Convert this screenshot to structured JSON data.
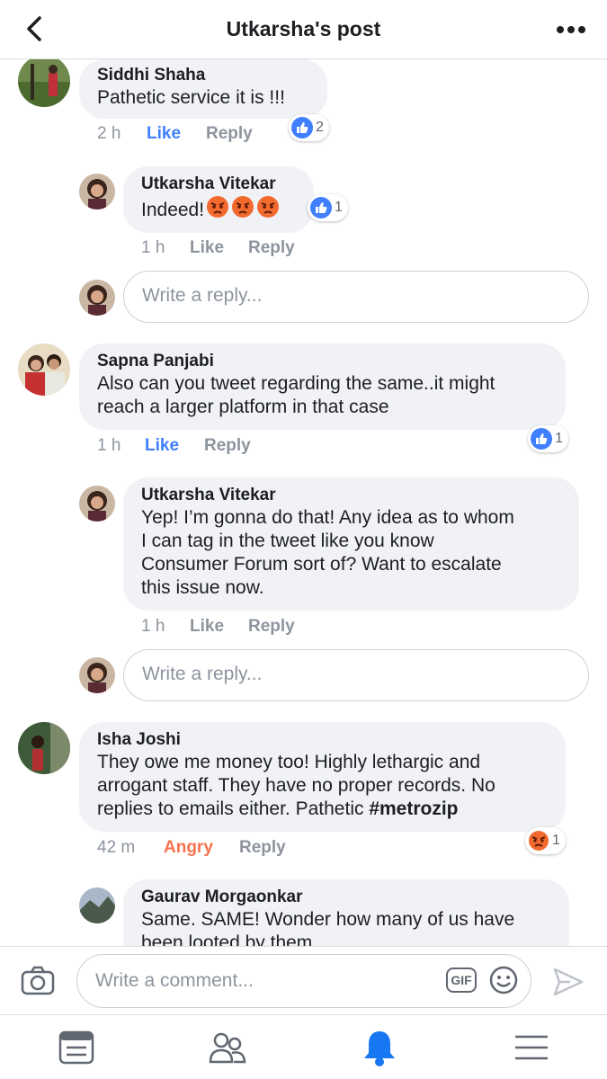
{
  "header": {
    "title": "Utkarsha's post"
  },
  "comments": [
    {
      "name": "Siddhi Shaha",
      "text": "Pathetic service it is !!!",
      "time": "2 h",
      "like": "Like",
      "reply": "Reply",
      "react_count": "2"
    },
    {
      "name": "Utkarsha Vitekar",
      "text": "Indeed!",
      "time": "1 h",
      "like": "Like",
      "reply": "Reply",
      "react_count": "1"
    },
    {
      "name": "Sapna Panjabi",
      "text_lines": [
        "Also can you tweet regarding the same..it might",
        "reach a larger platform in that case"
      ],
      "time": "1 h",
      "like": "Like",
      "reply": "Reply",
      "react_count": "1"
    },
    {
      "name": "Utkarsha Vitekar",
      "text_lines": [
        "Yep! I’m gonna do that! Any idea as to whom",
        "I can tag in the tweet like you know",
        "Consumer Forum sort of? Want to escalate",
        "this issue now."
      ],
      "time": "1 h",
      "like": "Like",
      "reply": "Reply"
    },
    {
      "name": "Isha Joshi",
      "text_lines": [
        "They owe me money too! Highly lethargic and",
        "arrogant staff. They have no proper records. No",
        "replies to emails either. Pathetic "
      ],
      "hashtag": "#metrozip",
      "time": "42 m",
      "reaction": "Angry",
      "reply": "Reply",
      "react_count": "1"
    },
    {
      "name": "Gaurav Morgaonkar",
      "text_lines": [
        "Same. SAME! Wonder how many of us have",
        "been looted by them"
      ]
    }
  ],
  "reply_placeholder": "Write a reply...",
  "composer": {
    "placeholder": "Write a comment...",
    "gif_label": "GIF"
  },
  "colors": {
    "like_blue": "#4080ff",
    "angry_orange": "#f7714c",
    "bubble": "#f0f2f5",
    "active_tab": "#1877f2"
  },
  "icons": [
    "back-icon",
    "more-icon",
    "camera-icon",
    "gif-icon",
    "smile-icon",
    "send-icon",
    "feed-icon",
    "friends-icon",
    "notifications-icon",
    "menu-icon",
    "like-reaction-icon",
    "angry-reaction-icon"
  ]
}
